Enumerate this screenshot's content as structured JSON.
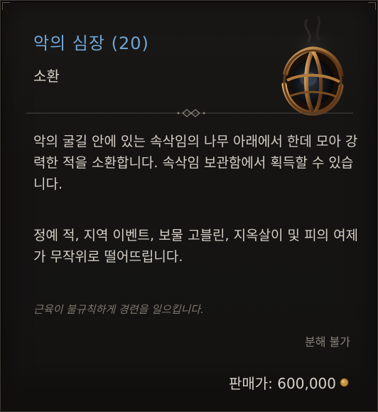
{
  "item": {
    "name": "악의 심장 (20)",
    "type": "소환",
    "icon": "malignant-heart-icon",
    "description_1": "악의 굴길 안에 있는 속삭임의 나무 아래에서 한데 모아 강력한 적을 소환합니다. 속삭임 보관함에서 획득할 수 있습니다.",
    "description_2": "정예 적, 지역 이벤트, 보물 고블린, 지옥살이 및 피의 여제가 무작위로 떨어뜨립니다.",
    "flavor": "근육이 불규칙하게 경련을 일으킵니다.",
    "salvage": "분해 불가",
    "price_label": "판매가:",
    "price_value": "600,000"
  },
  "colors": {
    "name": "#6ea6d6",
    "text": "#d6d0c6",
    "flavor": "#7d776e",
    "gold": "#c8963c"
  }
}
